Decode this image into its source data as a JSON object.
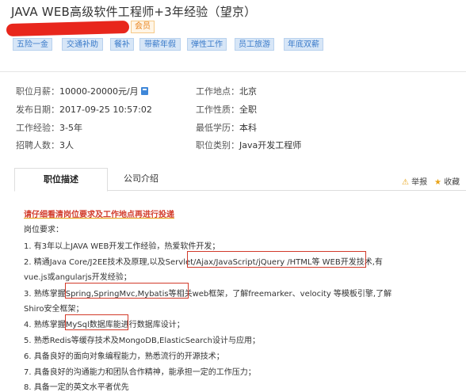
{
  "job": {
    "title": "JAVA WEB高级软件工程师+3年经验（望京）",
    "member_badge": "会员"
  },
  "tags": [
    "五险一金",
    "交通补助",
    "餐补",
    "带薪年假",
    "弹性工作",
    "员工旅游",
    "年底双薪"
  ],
  "info": {
    "salary_label": "职位月薪：",
    "salary_value": "10000-20000元/月",
    "location_label": "工作地点：",
    "location_value": "北京",
    "publish_label": "发布日期：",
    "publish_value": "2017-09-25 10:57:02",
    "nature_label": "工作性质：",
    "nature_value": "全职",
    "exp_label": "工作经验：",
    "exp_value": "3-5年",
    "edu_label": "最低学历：",
    "edu_value": "本科",
    "count_label": "招聘人数：",
    "count_value": "3人",
    "category_label": "职位类别：",
    "category_value": "Java开发工程师"
  },
  "tabs": {
    "description": "职位描述",
    "company": "公司介绍"
  },
  "actions": {
    "report": "举报",
    "favorite": "收藏"
  },
  "description": {
    "notice": "请仔细看清岗位要求及工作地点再进行投递",
    "heading": "岗位要求：",
    "lines": [
      "1.  有3年以上JAVA WEB开发工作经验，热爱软件开发；",
      "2.  精通Java Core/J2EE技术及原理,以及Servlet/Ajax/JavaScript/jQuery /HTML等      WEB开发技术,有",
      "vue.js或angularjs开发经验；",
      "3.  熟练掌握Spring,SpringMvc,Mybatis等相关web框架，了解freemarker、velocity     等模板引擎,了解",
      "Shiro安全框架；",
      "4.  熟练掌握MySql数据库能进行数据库设计；",
      "5.  熟悉Redis等缓存技术及MongoDB,ElasticSearch设计与应用；",
      "6.  具备良好的面向对象编程能力，熟悉流行的开源技术；",
      "7.  具备良好的沟通能力和团队合作精神，能承担一定的工作压力；",
      "8.  具备一定的英文水平者优先"
    ]
  },
  "colors": {
    "tag_text": "#3a7ac9",
    "tag_bg": "#d7e6f7",
    "highlight": "#d23a2a",
    "member": "#e8821b"
  }
}
